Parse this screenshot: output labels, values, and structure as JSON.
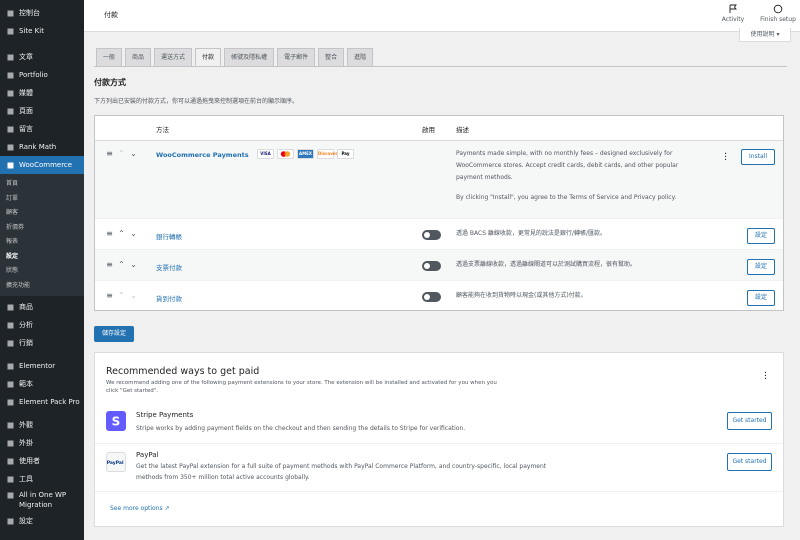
{
  "sidebar": {
    "items": [
      {
        "label": "控制台",
        "icon": "dashboard-icon"
      },
      {
        "label": "Site Kit",
        "icon": "sitekit-icon"
      },
      {
        "label": "文章",
        "icon": "pin-icon"
      },
      {
        "label": "Portfolio",
        "icon": "portfolio-icon"
      },
      {
        "label": "媒體",
        "icon": "media-icon"
      },
      {
        "label": "頁面",
        "icon": "page-icon"
      },
      {
        "label": "留言",
        "icon": "comment-icon"
      },
      {
        "label": "Rank Math",
        "icon": "rankmath-icon"
      },
      {
        "label": "WooCommerce",
        "icon": "woo-icon"
      }
    ],
    "woo_sub": [
      "首頁",
      "訂單",
      "顧客",
      "折價券",
      "報表",
      "設定",
      "狀態",
      "擴充功能"
    ],
    "items2": [
      {
        "label": "商品",
        "icon": "product-icon"
      },
      {
        "label": "分析",
        "icon": "analytics-icon"
      },
      {
        "label": "行銷",
        "icon": "megaphone-icon"
      },
      {
        "label": "Elementor",
        "icon": "elementor-icon"
      },
      {
        "label": "範本",
        "icon": "template-icon"
      },
      {
        "label": "Element Pack Pro",
        "icon": "elementpack-icon"
      },
      {
        "label": "外觀",
        "icon": "brush-icon"
      },
      {
        "label": "外掛",
        "icon": "plugin-icon"
      },
      {
        "label": "使用者",
        "icon": "user-icon"
      },
      {
        "label": "工具",
        "icon": "wrench-icon"
      },
      {
        "label": "All in One WP Migration",
        "icon": "migration-icon"
      },
      {
        "label": "設定",
        "icon": "settings-icon"
      }
    ]
  },
  "header": {
    "title": "付款",
    "activity": "Activity",
    "finish_setup": "Finish setup",
    "help": "使用說明 ▾"
  },
  "tabs": [
    "一般",
    "商品",
    "運送方式",
    "付款",
    "帳號及隱私權",
    "電子郵件",
    "整合",
    "進階"
  ],
  "active_tab": 3,
  "section": {
    "title": "付款方式",
    "desc": "下方列出已安裝的付款方式，你可以通過拖曳來控制選項在前台的顯示順序。"
  },
  "table": {
    "headers": {
      "method": "方法",
      "enabled": "啟用",
      "description": "描述"
    },
    "rows": [
      {
        "name": "WooCommerce Payments",
        "desc_lines": [
          "Payments made simple, with no monthly fees – designed exclusively for",
          "WooCommerce stores. Accept credit cards, debit cards, and other popular",
          "payment methods."
        ],
        "terms": "By clicking \"Install\", you agree to the Terms of Service and Privacy policy.",
        "button": "Install",
        "cards": [
          "VISA",
          "MC",
          "AMEX",
          "Discover",
          "Pay"
        ]
      },
      {
        "name": "銀行轉帳",
        "desc": "透過 BACS 離線收款，更常見的說法是銀行/轉帳/匯款。",
        "button": "設定"
      },
      {
        "name": "支票付款",
        "desc": "透過支票離線收款，透過離線閘道可以於測試購買流程，很有幫助。",
        "button": "設定"
      },
      {
        "name": "貨到付款",
        "desc": "顧客能夠在收到貨物時以現金(或其他方式)付款。",
        "button": "設定"
      }
    ]
  },
  "save_label": "儲存設定",
  "recommended": {
    "title": "Recommended ways to get paid",
    "desc": "We recommend adding one of the following payment extensions to your store. The extension will be installed and activated for you when you click \"Get started\".",
    "items": [
      {
        "name": "Stripe Payments",
        "text": "Stripe works by adding payment fields on the checkout and then sending the details to Stripe for verification.",
        "button": "Get started"
      },
      {
        "name": "PayPal",
        "text": "Get the latest PayPal extension for a full suite of payment methods with PayPal Commerce Platform, and country-specific, local payment methods from 350+ million total active accounts globally.",
        "button": "Get started"
      }
    ],
    "more": "See more options"
  }
}
